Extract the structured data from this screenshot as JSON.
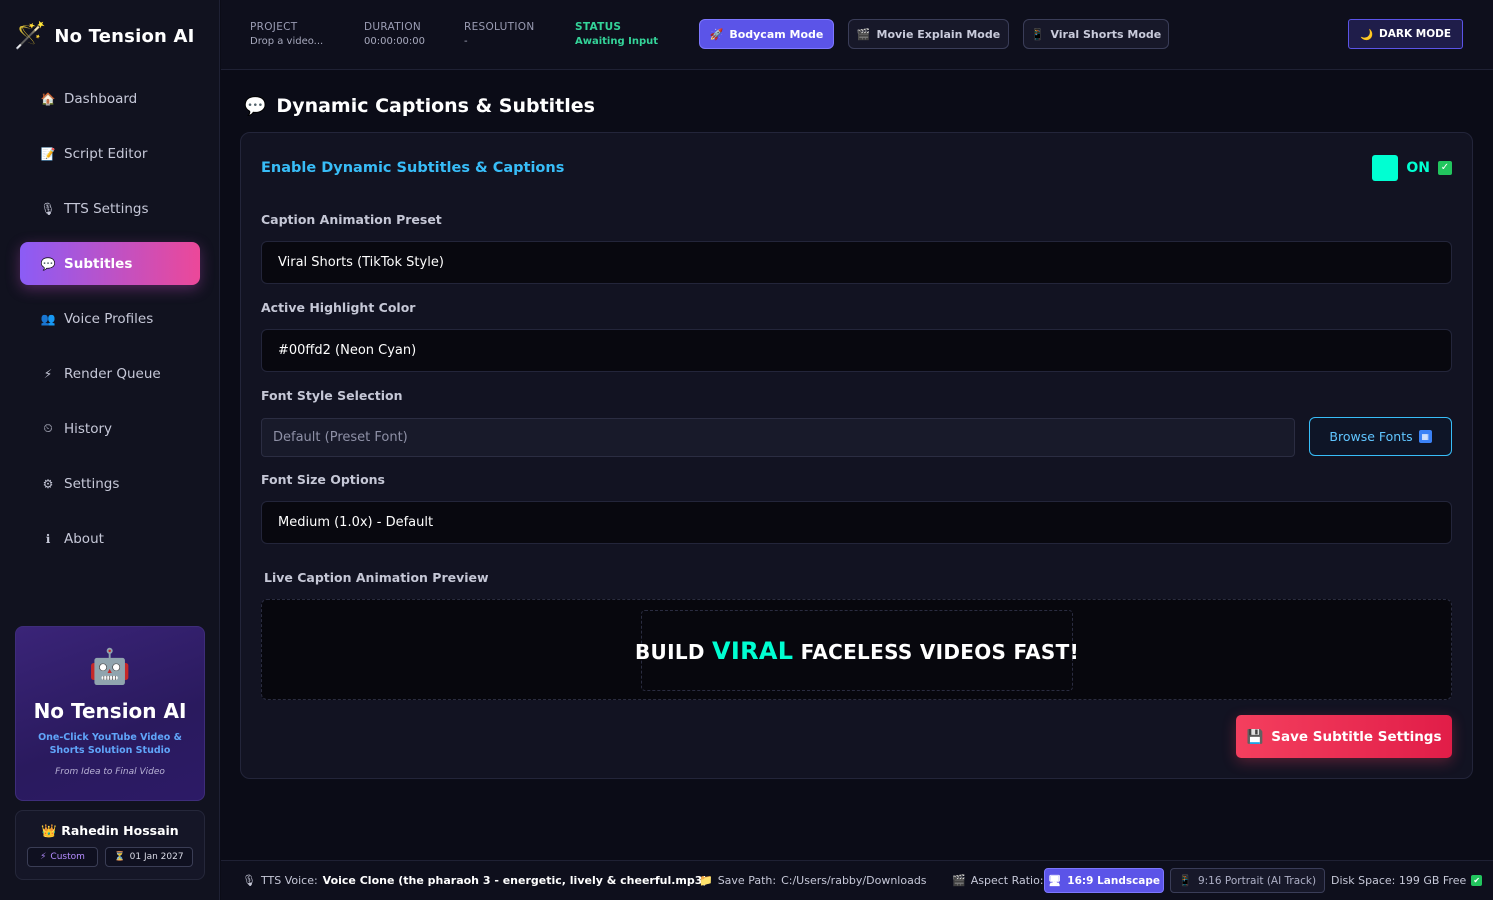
{
  "app": {
    "name": "No Tension AI",
    "logo_icon": "🪄"
  },
  "sidebar": {
    "items": [
      {
        "label": "Dashboard",
        "icon": "🏠"
      },
      {
        "label": "Script Editor",
        "icon": "📝"
      },
      {
        "label": "TTS Settings",
        "icon": "🎙"
      },
      {
        "label": "Subtitles",
        "icon": "💬"
      },
      {
        "label": "Voice Profiles",
        "icon": "👥"
      },
      {
        "label": "Render Queue",
        "icon": "⚡"
      },
      {
        "label": "History",
        "icon": "⏲"
      },
      {
        "label": "Settings",
        "icon": "⚙"
      },
      {
        "label": "About",
        "icon": "ℹ"
      }
    ],
    "active_index": 3,
    "promo": {
      "icon": "🤖",
      "title": "No Tension AI",
      "subtitle": "One-Click YouTube Video & Shorts Solution Studio",
      "tagline": "From Idea to Final Video"
    },
    "user": {
      "icon": "👑",
      "name": "Rahedin Hossain",
      "plan": "Custom",
      "plan_icon": "⚡",
      "expiry": "01 Jan 2027",
      "expiry_icon": "⏳"
    }
  },
  "topbar": {
    "project": {
      "label": "PROJECT",
      "value": "Drop a video..."
    },
    "duration": {
      "label": "DURATION",
      "value": "00:00:00:00"
    },
    "resolution": {
      "label": "RESOLUTION",
      "value": "-"
    },
    "status": {
      "label": "STATUS",
      "value": "Awaiting Input"
    },
    "modes": [
      {
        "label": "Bodycam Mode",
        "icon": "🚀",
        "active": true
      },
      {
        "label": "Movie Explain Mode",
        "icon": "🎬",
        "active": false
      },
      {
        "label": "Viral Shorts Mode",
        "icon": "📱",
        "active": false
      }
    ],
    "theme_button": {
      "label": "DARK MODE",
      "icon": "🌙"
    }
  },
  "main": {
    "title": "Dynamic Captions & Subtitles",
    "title_icon": "💬",
    "enable": {
      "label": "Enable Dynamic Subtitles & Captions",
      "state": "ON",
      "color": "#00ffd2"
    },
    "preset": {
      "label": "Caption Animation Preset",
      "value": "Viral Shorts (TikTok Style)"
    },
    "highlight": {
      "label": "Active Highlight Color",
      "value": "#00ffd2 (Neon Cyan)"
    },
    "font_style": {
      "label": "Font Style Selection",
      "placeholder": "Default (Preset Font)",
      "browse_label": "Browse Fonts",
      "browse_icon": "🔠"
    },
    "font_size": {
      "label": "Font Size Options",
      "value": "Medium (1.0x) - Default"
    },
    "preview": {
      "label": "Live Caption Animation Preview",
      "before": "BUILD",
      "highlight": "VIRAL",
      "after": "FACELESS VIDEOS FAST!"
    },
    "save_button": {
      "label": "Save Subtitle Settings",
      "icon": "💾"
    }
  },
  "footer": {
    "tts": {
      "label": "TTS Voice:",
      "value": "Voice Clone (the pharaoh 3 - energetic, lively & cheerful.mp3)",
      "icon": "🎙"
    },
    "save_path": {
      "label": "Save Path:",
      "value": "C:/Users/rabby/Downloads",
      "icon": "📁"
    },
    "aspect": {
      "label": "Aspect Ratio:",
      "icon": "🎬",
      "options": [
        {
          "label": "16:9 Landscape",
          "icon": "🖥",
          "active": true
        },
        {
          "label": "9:16 Portrait (AI Track)",
          "icon": "📱",
          "active": false
        }
      ]
    },
    "disk": {
      "label": "Disk Space: 199 GB Free",
      "icon": "✔"
    }
  },
  "colors": {
    "accent": "#5b54e8",
    "highlight": "#00ffd2",
    "link": "#38bdf8",
    "danger": "#f43f5e",
    "status_ok": "#34d399"
  }
}
